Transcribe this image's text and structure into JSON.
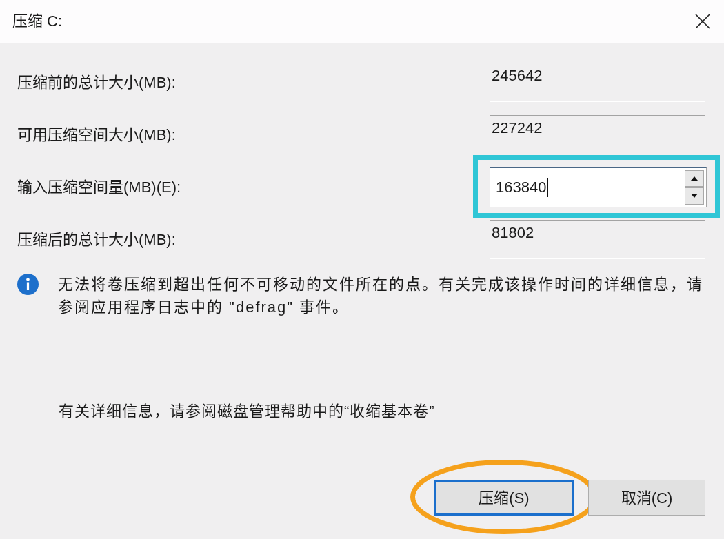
{
  "window": {
    "title": "压缩 C:"
  },
  "fields": [
    {
      "kind": "readonly",
      "label": "压缩前的总计大小(MB):",
      "value": "245642",
      "highlighted": false
    },
    {
      "kind": "readonly",
      "label": "可用压缩空间大小(MB):",
      "value": "227242",
      "highlighted": false
    },
    {
      "kind": "spin",
      "label": "输入压缩空间量(MB)(E):",
      "value": "163840",
      "focused": true,
      "highlighted": true
    },
    {
      "kind": "readonly",
      "label": "压缩后的总计大小(MB):",
      "value": "81802",
      "highlighted": false
    }
  ],
  "info_message": "无法将卷压缩到超出任何不可移动的文件所在的点。有关完成该操作时间的详细信息，请参阅应用程序日志中的 \"defrag\" 事件。",
  "help_text": "有关详细信息，请参阅磁盘管理帮助中的“收缩基本卷”",
  "buttons": [
    {
      "label": "压缩(S)",
      "default": true,
      "highlighted": true
    },
    {
      "label": "取消(C)",
      "default": false,
      "highlighted": false
    }
  ]
}
